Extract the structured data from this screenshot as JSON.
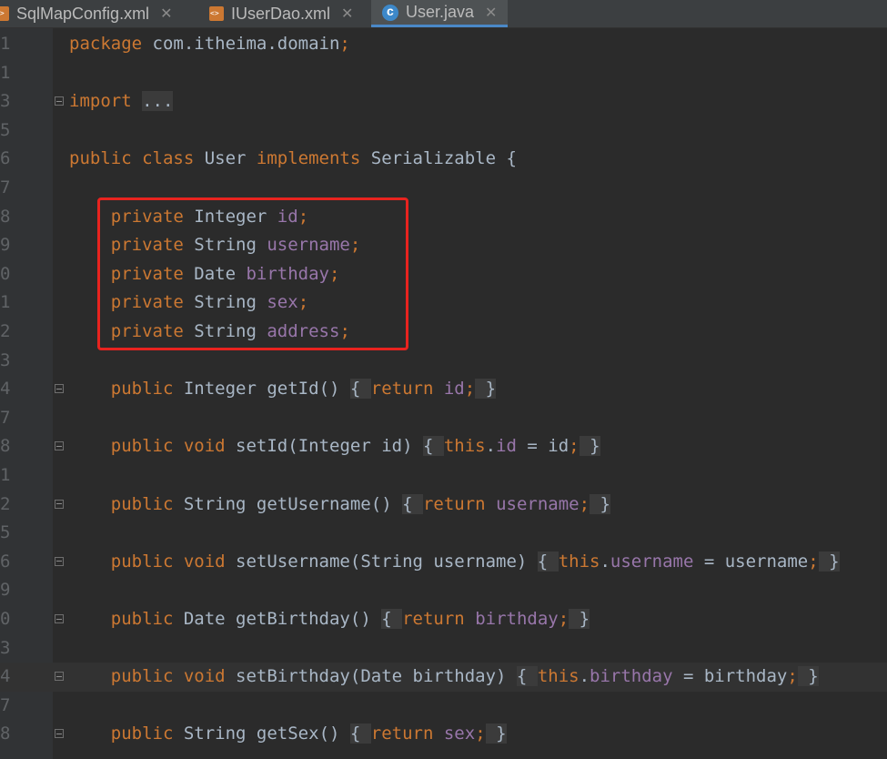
{
  "tabs": [
    {
      "name": "SqlMapConfig.xml",
      "icon": "xml-file-icon",
      "active": false
    },
    {
      "name": "IUserDao.xml",
      "icon": "xml-file-icon",
      "active": false
    },
    {
      "name": "User.java",
      "icon": "java-class-icon",
      "active": true
    }
  ],
  "lines": [
    {
      "num": "1",
      "parts": [
        [
          "k",
          "package "
        ],
        [
          "t",
          "com.itheima.domain"
        ],
        [
          "k",
          ";"
        ]
      ]
    },
    {
      "num": "1",
      "parts": []
    },
    {
      "num": "3",
      "fold": true,
      "parts": [
        [
          "k",
          "import "
        ],
        [
          "dots",
          "..."
        ]
      ]
    },
    {
      "num": "5",
      "parts": []
    },
    {
      "num": "6",
      "parts": [
        [
          "k",
          "public class "
        ],
        [
          "t",
          "User "
        ],
        [
          "k",
          "implements "
        ],
        [
          "t",
          "Serializable {"
        ]
      ]
    },
    {
      "num": "7",
      "parts": []
    },
    {
      "num": "8",
      "parts": [
        [
          "t",
          "    "
        ],
        [
          "k",
          "private "
        ],
        [
          "t",
          "Integer "
        ],
        [
          "f",
          "id"
        ],
        [
          "k",
          ";"
        ]
      ]
    },
    {
      "num": "9",
      "parts": [
        [
          "t",
          "    "
        ],
        [
          "k",
          "private "
        ],
        [
          "t",
          "String "
        ],
        [
          "f",
          "username"
        ],
        [
          "k",
          ";"
        ]
      ]
    },
    {
      "num": "0",
      "parts": [
        [
          "t",
          "    "
        ],
        [
          "k",
          "private "
        ],
        [
          "t",
          "Date "
        ],
        [
          "f",
          "birthday"
        ],
        [
          "k",
          ";"
        ]
      ]
    },
    {
      "num": "1",
      "parts": [
        [
          "t",
          "    "
        ],
        [
          "k",
          "private "
        ],
        [
          "t",
          "String "
        ],
        [
          "f",
          "sex"
        ],
        [
          "k",
          ";"
        ]
      ]
    },
    {
      "num": "2",
      "parts": [
        [
          "t",
          "    "
        ],
        [
          "k",
          "private "
        ],
        [
          "t",
          "String "
        ],
        [
          "f",
          "address"
        ],
        [
          "k",
          ";"
        ]
      ]
    },
    {
      "num": "3",
      "parts": []
    },
    {
      "num": "4",
      "fold": true,
      "parts": [
        [
          "t",
          "    "
        ],
        [
          "k",
          "public "
        ],
        [
          "t",
          "Integer "
        ],
        [
          "mdim",
          "getId"
        ],
        [
          "t",
          "() "
        ],
        [
          "fb",
          "{ "
        ],
        [
          "k",
          "return "
        ],
        [
          "f",
          "id"
        ],
        [
          "k",
          ";"
        ],
        [
          "fb",
          " }"
        ]
      ]
    },
    {
      "num": "7",
      "parts": []
    },
    {
      "num": "8",
      "fold": true,
      "parts": [
        [
          "t",
          "    "
        ],
        [
          "k",
          "public void "
        ],
        [
          "mdim",
          "setId"
        ],
        [
          "t",
          "(Integer id) "
        ],
        [
          "fb",
          "{ "
        ],
        [
          "k",
          "this"
        ],
        [
          "t",
          "."
        ],
        [
          "f",
          "id "
        ],
        [
          "t",
          "= id"
        ],
        [
          "k",
          ";"
        ],
        [
          "fb",
          " }"
        ]
      ]
    },
    {
      "num": "1",
      "parts": []
    },
    {
      "num": "2",
      "fold": true,
      "parts": [
        [
          "t",
          "    "
        ],
        [
          "k",
          "public "
        ],
        [
          "t",
          "String "
        ],
        [
          "mdim",
          "getUsername"
        ],
        [
          "t",
          "() "
        ],
        [
          "fb",
          "{ "
        ],
        [
          "k",
          "return "
        ],
        [
          "f",
          "username"
        ],
        [
          "k",
          ";"
        ],
        [
          "fb",
          " }"
        ]
      ]
    },
    {
      "num": "5",
      "parts": []
    },
    {
      "num": "6",
      "fold": true,
      "parts": [
        [
          "t",
          "    "
        ],
        [
          "k",
          "public void "
        ],
        [
          "mdim",
          "setUsername"
        ],
        [
          "t",
          "(String username) "
        ],
        [
          "fb",
          "{ "
        ],
        [
          "k",
          "this"
        ],
        [
          "t",
          "."
        ],
        [
          "f",
          "username "
        ],
        [
          "t",
          "= username"
        ],
        [
          "k",
          ";"
        ],
        [
          "fb",
          " }"
        ]
      ]
    },
    {
      "num": "9",
      "parts": []
    },
    {
      "num": "0",
      "fold": true,
      "parts": [
        [
          "t",
          "    "
        ],
        [
          "k",
          "public "
        ],
        [
          "t",
          "Date "
        ],
        [
          "mdim",
          "getBirthday"
        ],
        [
          "t",
          "() "
        ],
        [
          "fb",
          "{ "
        ],
        [
          "k",
          "return "
        ],
        [
          "f",
          "birthday"
        ],
        [
          "k",
          ";"
        ],
        [
          "fb",
          " }"
        ]
      ]
    },
    {
      "num": "3",
      "parts": []
    },
    {
      "num": "4",
      "fold": true,
      "current": true,
      "parts": [
        [
          "t",
          "    "
        ],
        [
          "k",
          "public void "
        ],
        [
          "mdim",
          "setBirthday"
        ],
        [
          "t",
          "(Date birthday) "
        ],
        [
          "fb",
          "{ "
        ],
        [
          "k",
          "this"
        ],
        [
          "t",
          "."
        ],
        [
          "f",
          "birthday "
        ],
        [
          "t",
          "= birthday"
        ],
        [
          "k",
          ";"
        ],
        [
          "fb",
          " }"
        ]
      ]
    },
    {
      "num": "7",
      "parts": []
    },
    {
      "num": "8",
      "fold": true,
      "parts": [
        [
          "t",
          "    "
        ],
        [
          "k",
          "public "
        ],
        [
          "t",
          "String "
        ],
        [
          "mdim",
          "getSex"
        ],
        [
          "t",
          "() "
        ],
        [
          "fb",
          "{ "
        ],
        [
          "k",
          "return "
        ],
        [
          "f",
          "sex"
        ],
        [
          "k",
          ";"
        ],
        [
          "fb",
          " }"
        ]
      ]
    }
  ]
}
